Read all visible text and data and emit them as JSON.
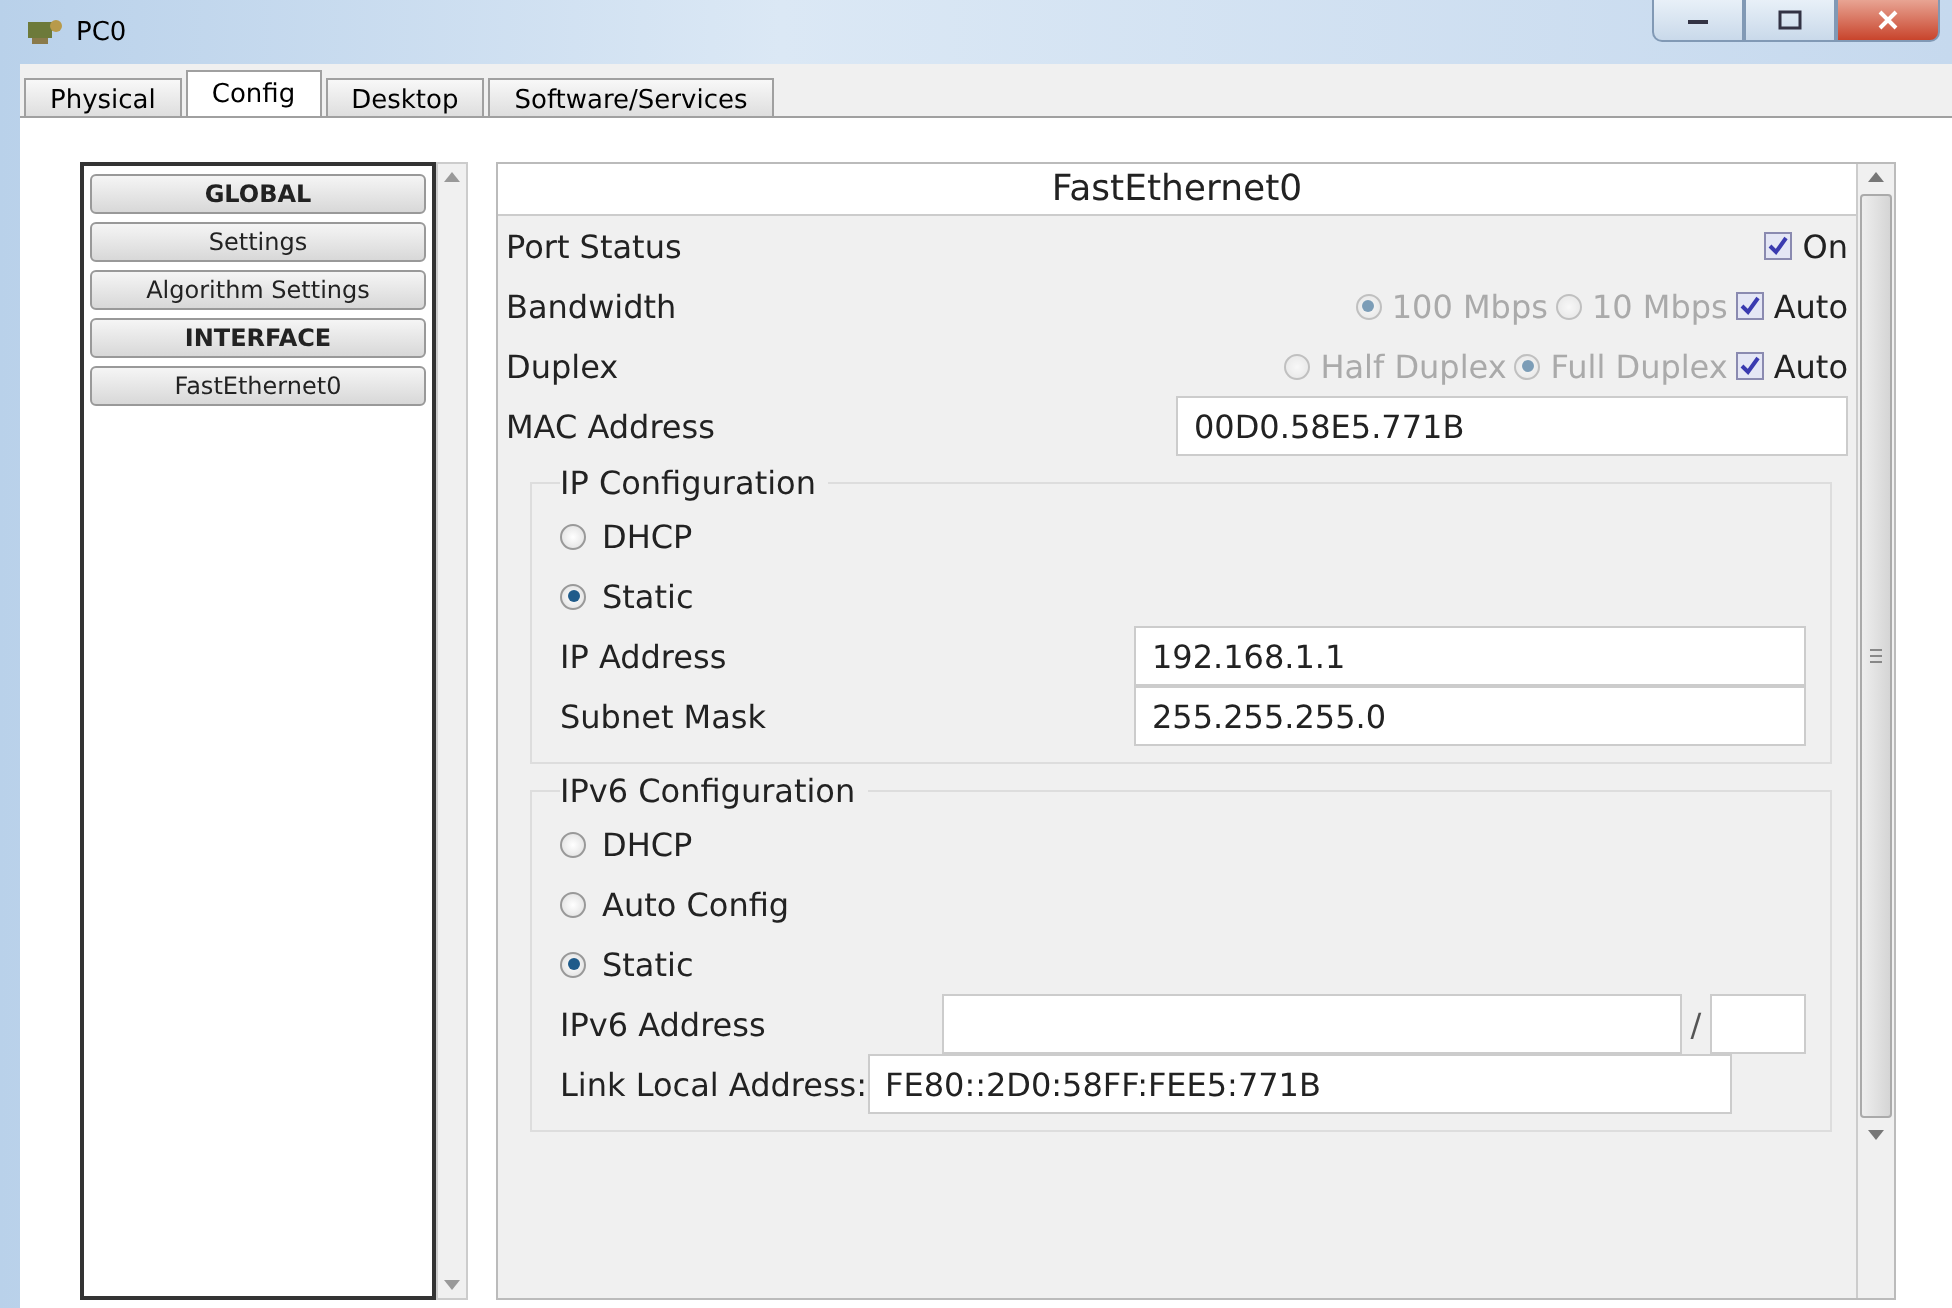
{
  "window": {
    "title": "PC0"
  },
  "tabs": [
    {
      "label": "Physical",
      "selected": false
    },
    {
      "label": "Config",
      "selected": true
    },
    {
      "label": "Desktop",
      "selected": false
    },
    {
      "label": "Software/Services",
      "selected": false
    }
  ],
  "sidebar": {
    "items": [
      {
        "label": "GLOBAL",
        "kind": "header"
      },
      {
        "label": "Settings",
        "kind": "item"
      },
      {
        "label": "Algorithm Settings",
        "kind": "item"
      },
      {
        "label": "INTERFACE",
        "kind": "header"
      },
      {
        "label": "FastEthernet0",
        "kind": "item"
      }
    ]
  },
  "panel": {
    "title": "FastEthernet0",
    "port_status": {
      "label": "Port Status",
      "option": "On",
      "checked": true
    },
    "bandwidth": {
      "label": "Bandwidth",
      "disabled": true,
      "options": [
        {
          "label": "100 Mbps",
          "selected": true
        },
        {
          "label": "10 Mbps",
          "selected": false
        }
      ],
      "auto": {
        "label": "Auto",
        "checked": true
      }
    },
    "duplex": {
      "label": "Duplex",
      "disabled": true,
      "options": [
        {
          "label": "Half Duplex",
          "selected": false
        },
        {
          "label": "Full Duplex",
          "selected": true
        }
      ],
      "auto": {
        "label": "Auto",
        "checked": true
      }
    },
    "mac": {
      "label": "MAC Address",
      "value": "00D0.58E5.771B"
    },
    "ip_config": {
      "title": "IP Configuration",
      "modes": [
        {
          "label": "DHCP",
          "selected": false
        },
        {
          "label": "Static",
          "selected": true
        }
      ],
      "fields": [
        {
          "label": "IP Address",
          "value": "192.168.1.1"
        },
        {
          "label": "Subnet Mask",
          "value": "255.255.255.0"
        }
      ]
    },
    "ipv6_config": {
      "title": "IPv6 Configuration",
      "modes": [
        {
          "label": "DHCP",
          "selected": false
        },
        {
          "label": "Auto Config",
          "selected": false
        },
        {
          "label": "Static",
          "selected": true
        }
      ],
      "address": {
        "label": "IPv6 Address",
        "separator": "/"
      },
      "link_local": {
        "label": "Link Local Address:",
        "value": "FE80::2D0:58FF:FEE5:771B"
      }
    }
  }
}
